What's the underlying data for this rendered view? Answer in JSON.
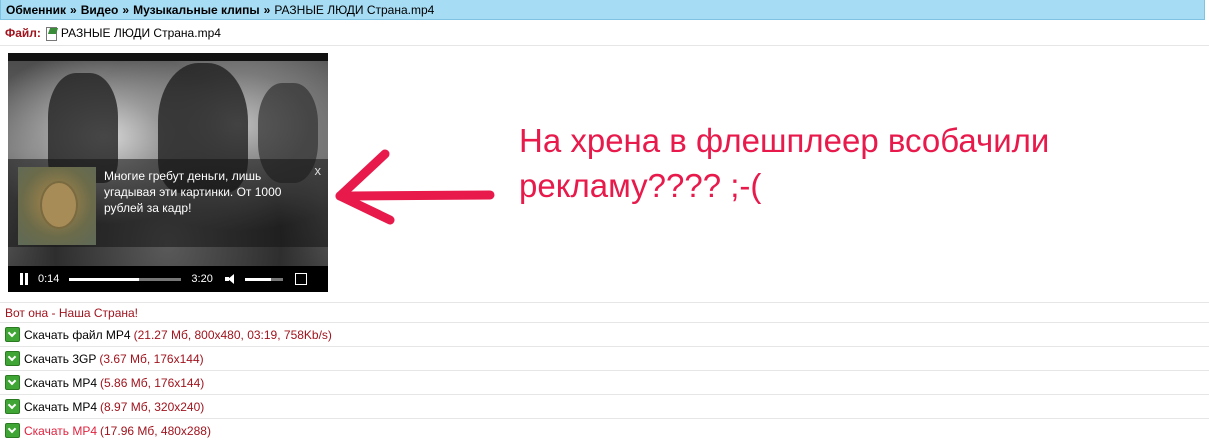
{
  "breadcrumb": {
    "items": [
      "Обменник",
      "Видео",
      "Музыкальные клипы"
    ],
    "separator": "»",
    "current": "РАЗНЫЕ ЛЮДИ Страна.mp4"
  },
  "file": {
    "label": "Файл:",
    "name": "РАЗНЫЕ ЛЮДИ Страна.mp4",
    "icon": "document-icon"
  },
  "player": {
    "ad": {
      "text": "Многие гребут деньги, лишь угадывая эти картинки. От 1000 рублей за кадр!",
      "close": "x"
    },
    "controls": {
      "current_time": "0:14",
      "total_time": "3:20",
      "progress_percent": 62,
      "volume_percent": 70
    }
  },
  "annotation": {
    "text": "На хрена в флешплеер всобачили рекламу???? ;-(",
    "color": "#e8194b"
  },
  "description": "Вот она - Наша Страна!",
  "downloads": [
    {
      "label": "Скачать файл MP4",
      "meta": "(21.27 Мб, 800x480, 03:19, 758Kb/s)",
      "highlight": false
    },
    {
      "label": "Скачать 3GP",
      "meta": "(3.67 Мб, 176x144)",
      "highlight": false
    },
    {
      "label": "Скачать MP4",
      "meta": "(5.86 Мб, 176x144)",
      "highlight": false
    },
    {
      "label": "Скачать MP4",
      "meta": "(8.97 Мб, 320x240)",
      "highlight": false
    },
    {
      "label": "Скачать MP4",
      "meta": "(17.96 Мб, 480x288)",
      "highlight": true
    }
  ]
}
